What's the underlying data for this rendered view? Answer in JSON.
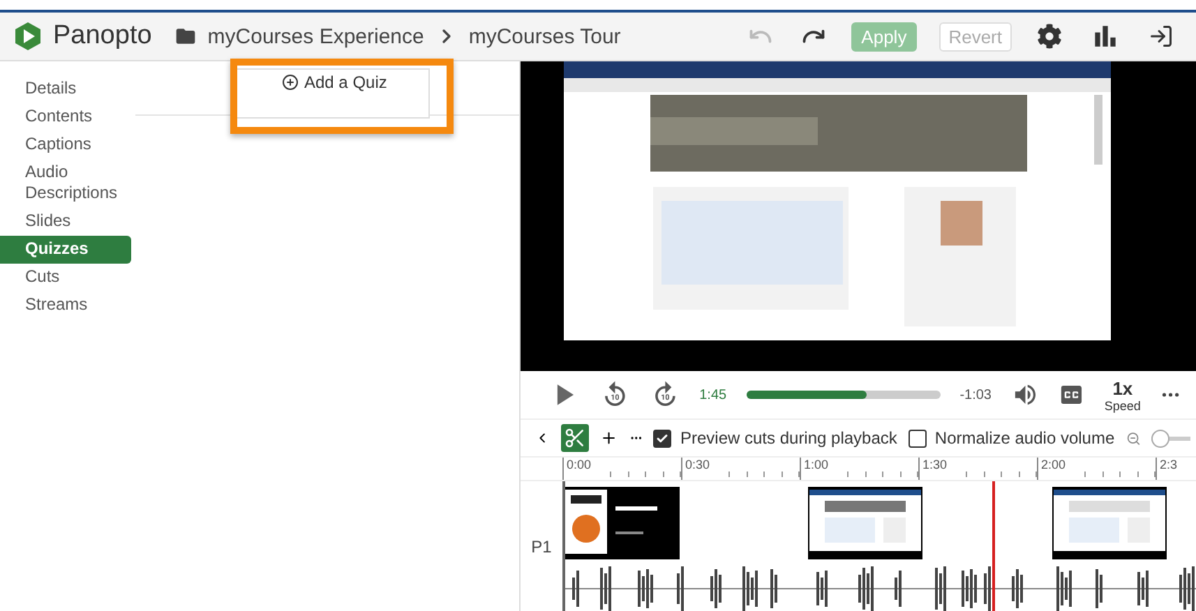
{
  "header": {
    "logo": "Panopto",
    "breadcrumb": [
      {
        "label": "myCourses Experience"
      },
      {
        "label": "myCourses Tour"
      }
    ],
    "history": [
      {
        "kind": "undo",
        "disabled": true
      },
      {
        "kind": "redo",
        "disabled": false
      }
    ],
    "buttons": [
      {
        "kind": "apply",
        "label": "Apply",
        "disabled": true
      },
      {
        "kind": "revert",
        "label": "Revert",
        "disabled": true
      }
    ]
  },
  "sidebar": {
    "items": [
      {
        "label": "Details",
        "selected": false
      },
      {
        "label": "Contents",
        "selected": false
      },
      {
        "label": "Captions",
        "selected": false
      },
      {
        "label": "Audio Descriptions",
        "selected": false
      },
      {
        "label": "Slides",
        "selected": false
      },
      {
        "label": "Quizzes",
        "selected": true
      },
      {
        "label": "Cuts",
        "selected": false
      },
      {
        "label": "Streams",
        "selected": false
      }
    ]
  },
  "quiz_panel": {
    "add_button": "Add a Quiz",
    "highlighted": true
  },
  "player": {
    "current_time": "1:45",
    "remaining_time": "-1:03",
    "progress": {
      "level": 0.62
    },
    "speed": "1x",
    "speed_label": "Speed"
  },
  "edit_toolbar": {
    "checkboxes": [
      {
        "label": "Preview cuts during playback",
        "checked": true
      },
      {
        "label": "Normalize audio volume",
        "checked": false
      }
    ],
    "zoom": {
      "level": 0
    }
  },
  "timeline": {
    "ticks": [
      "0:00",
      "0:30",
      "1:00",
      "1:30",
      "2:00",
      "2:3"
    ],
    "track_label": "P1"
  }
}
